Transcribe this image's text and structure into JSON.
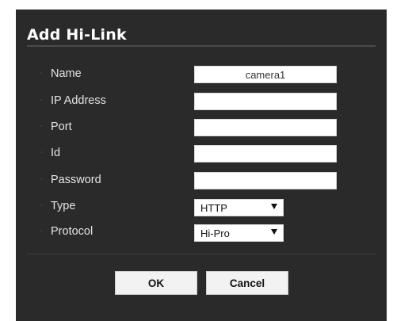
{
  "dialog": {
    "title": "Add Hi-Link"
  },
  "fields": [
    {
      "label": "Name",
      "value": "camera1",
      "kind": "text"
    },
    {
      "label": "IP Address",
      "value": "",
      "kind": "text"
    },
    {
      "label": "Port",
      "value": "",
      "kind": "text"
    },
    {
      "label": "Id",
      "value": "",
      "kind": "text"
    },
    {
      "label": "Password",
      "value": "",
      "kind": "password"
    },
    {
      "label": "Type",
      "value": "HTTP",
      "kind": "select"
    },
    {
      "label": "Protocol",
      "value": "Hi-Pro",
      "kind": "select"
    }
  ],
  "bullet_glyph": "·",
  "buttons": {
    "ok": "OK",
    "cancel": "Cancel"
  },
  "colors": {
    "dialog_background": "#2a2a2a",
    "label_text": "#e4e4e4",
    "input_background": "#ffffff",
    "button_background": "#f2f2f2"
  }
}
